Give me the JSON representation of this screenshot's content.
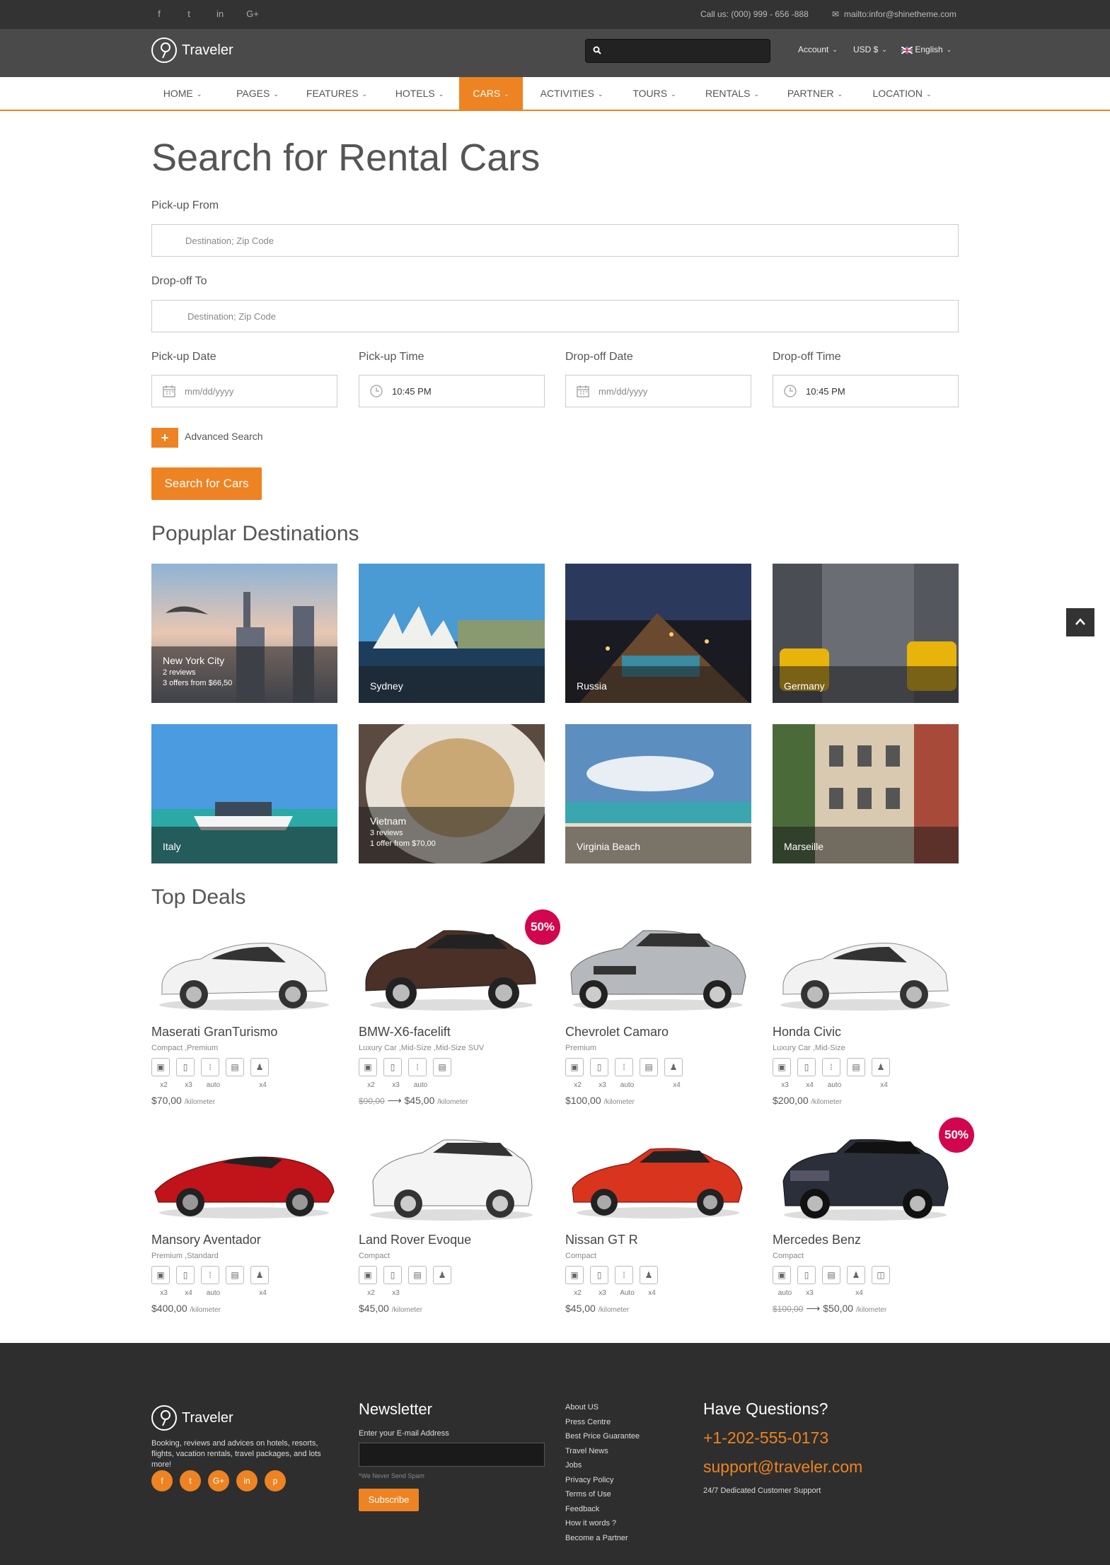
{
  "topbar": {
    "social": [
      "f",
      "t",
      "in",
      "G+"
    ],
    "call": "Call us: (000) 999 - 656 -888",
    "mail": "mailto:infor@shinetheme.com"
  },
  "header": {
    "logo": "Traveler",
    "account": "Account",
    "currency": "USD $",
    "language": "English"
  },
  "nav": [
    "HOME",
    "PAGES",
    "FEATURES",
    "HOTELS",
    "CARS",
    "ACTIVITIES",
    "TOURS",
    "RENTALS",
    "PARTNER",
    "LOCATION"
  ],
  "search_form": {
    "title": "Search for Rental Cars",
    "pickup_from": "Pick-up From",
    "dropoff_to": "Drop-off To",
    "placeholder": "Destination; Zip Code",
    "pickup_date": "Pick-up Date",
    "pickup_time": "Pick-up Time",
    "dropoff_date": "Drop-off Date",
    "dropoff_time": "Drop-off Time",
    "date_placeholder": "mm/dd/yyyy",
    "time_value": "10:45 PM",
    "advanced": "Advanced Search",
    "submit": "Search for Cars"
  },
  "destinations": {
    "title": "Popuplar Destinations",
    "items": [
      {
        "name": "New York City",
        "reviews": "2 reviews",
        "offers": "3 offers from $66,50"
      },
      {
        "name": "Sydney"
      },
      {
        "name": "Russia"
      },
      {
        "name": "Germany"
      },
      {
        "name": "Italy"
      },
      {
        "name": "Vietnam",
        "reviews": "3 reviews",
        "offers": "1 offer from $70,00"
      },
      {
        "name": "Virginia Beach"
      },
      {
        "name": "Marseille"
      }
    ]
  },
  "deals": {
    "title": "Top Deals",
    "unit": "/kilometer",
    "badge": "50%",
    "cars": [
      {
        "name": "Maserati GranTurismo",
        "type": "Compact ,Premium",
        "feats": [
          "x2",
          "x3",
          "auto",
          "",
          "x4"
        ],
        "price": "$70,00"
      },
      {
        "name": "BMW-X6-facelift",
        "type": "Luxury Car ,Mid-Size ,Mid-Size SUV",
        "feats": [
          "x2",
          "x3",
          "auto",
          ""
        ],
        "old": "$90,00",
        "price": "$45,00"
      },
      {
        "name": "Chevrolet Camaro",
        "type": "Premium",
        "feats": [
          "x2",
          "x3",
          "auto",
          "",
          "x4"
        ],
        "price": "$100,00"
      },
      {
        "name": "Honda Civic",
        "type": "Luxury Car ,Mid-Size",
        "feats": [
          "x3",
          "x4",
          "auto",
          "",
          "x4"
        ],
        "price": "$200,00"
      },
      {
        "name": "Mansory Aventador",
        "type": "Premium ,Standard",
        "feats": [
          "x3",
          "x4",
          "auto",
          "",
          "x4"
        ],
        "price": "$400,00"
      },
      {
        "name": "Land Rover Evoque",
        "type": "Compact",
        "feats": [
          "x2",
          "x3",
          "",
          ""
        ],
        "price": "$45,00"
      },
      {
        "name": "Nissan GT R",
        "type": "Compact",
        "feats": [
          "x2",
          "x3",
          "Auto",
          "x4"
        ],
        "price": "$45,00"
      },
      {
        "name": "Mercedes Benz",
        "type": "Compact",
        "feats": [
          "auto",
          "x3",
          "",
          "x4",
          ""
        ],
        "old": "$100,00",
        "price": "$50,00"
      }
    ]
  },
  "footer": {
    "logo": "Traveler",
    "about": "Booking, reviews and advices on hotels, resorts, flights, vacation rentals, travel packages, and lots more!",
    "social": [
      "f",
      "t",
      "G+",
      "in",
      "p"
    ],
    "newsletter_title": "Newsletter",
    "newsletter_label": "Enter your E-mail Address",
    "newsletter_note": "*We Never Send Spam",
    "subscribe": "Subscribe",
    "links": [
      "About US",
      "Press Centre",
      "Best Price Guarantee",
      "Travel News",
      "Jobs",
      "Privacy Policy",
      "Terms of Use",
      "Feedback",
      "How it words ?",
      "Become a Partner"
    ],
    "questions_title": "Have Questions?",
    "phone": "+1-202-555-0173",
    "email": "support@traveler.com",
    "support": "24/7 Dedicated Customer Support"
  },
  "colors": {
    "accent": "#ed8323",
    "badge": "#d2064e",
    "dark": "#333333",
    "footer": "#2e2e2e"
  }
}
